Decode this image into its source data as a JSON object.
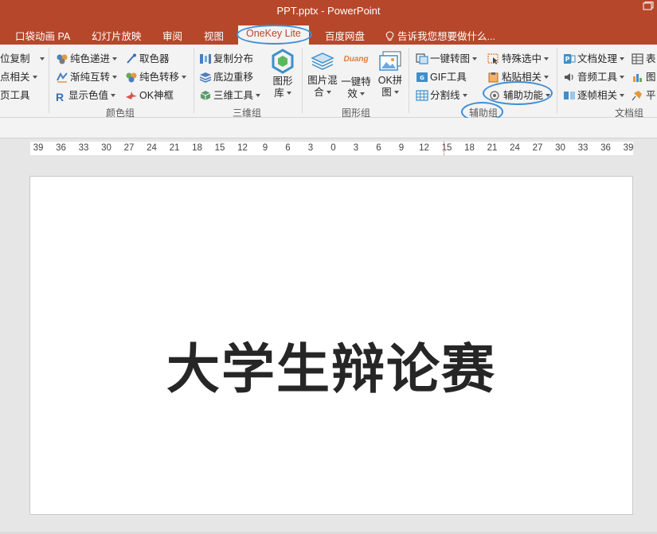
{
  "window": {
    "title": "PPT.pptx - PowerPoint"
  },
  "tabs": [
    {
      "label": "口袋动画 PA"
    },
    {
      "label": "幻灯片放映"
    },
    {
      "label": "审阅"
    },
    {
      "label": "视图"
    },
    {
      "label": "OneKey Lite",
      "active": true
    },
    {
      "label": "百度网盘"
    }
  ],
  "tell_me": {
    "label": "告诉我您想要做什么..."
  },
  "ribbon": {
    "groups": {
      "color": {
        "label": "颜色组"
      },
      "three_d": {
        "label": "三维组"
      },
      "shape": {
        "label": "图形组"
      },
      "aux": {
        "label": "辅助组"
      },
      "doc": {
        "label": "文档组"
      }
    },
    "left_partial": {
      "row1": "位复制",
      "row2": "点相关",
      "row3": "页工具"
    },
    "color_group": {
      "pure_gradient": "纯色递进",
      "color_picker": "取色器",
      "gradient_pure": "渐纯互转",
      "pure_transfer": "纯色转移",
      "show_color_value": "显示色值",
      "ok_frame": "OK神框"
    },
    "three_d_group": {
      "copy_distribute": "复制分布",
      "bottom_reposition": "底边重移",
      "three_d_tools": "三维工具",
      "shape_library": "图形库"
    },
    "shape_group": {
      "image_mix": "图片混合",
      "one_click_effect": "一键特效",
      "ok_collage": "OK拼图",
      "duang_text": "Duang"
    },
    "aux_group": {
      "one_click_to_image": "一键转图",
      "special_select": "特殊选中",
      "gif_tool": "GIF工具",
      "paste_related": "粘贴相关",
      "split_line": "分割线",
      "aux_function": "辅助功能"
    },
    "doc_group": {
      "doc_process": "文档处理",
      "audio_tools": "音频工具",
      "frame_related": "逐帧相关",
      "partial_table": "表",
      "partial_chart": "图",
      "partial_flat": "平"
    }
  },
  "ruler": {
    "numbers": [
      "39",
      "36",
      "33",
      "30",
      "27",
      "24",
      "21",
      "18",
      "15",
      "12",
      "9",
      "6",
      "3",
      "0",
      "3",
      "6",
      "9",
      "12",
      "15",
      "18",
      "21",
      "24",
      "27",
      "30",
      "33",
      "36",
      "39"
    ]
  },
  "slide": {
    "title": "大学生辩论赛"
  },
  "colors": {
    "accent": "#b7472a",
    "highlight_circle": "#3d8ed8"
  }
}
